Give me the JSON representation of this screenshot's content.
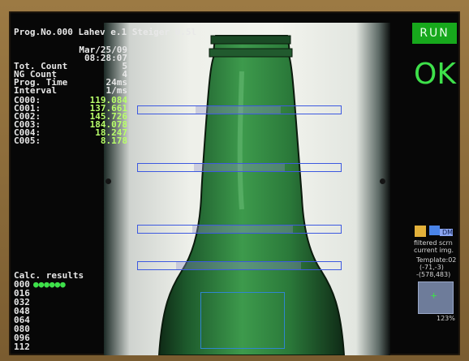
{
  "header": {
    "title": "Prog.No.000 Lahev e.1 Steiger 0.5l"
  },
  "status": {
    "run_label": "RUN",
    "result_label": "OK"
  },
  "info": {
    "date": "Mar/25/09",
    "time": "08:28:07",
    "rows": [
      {
        "label": "Tot. Count",
        "value": "5"
      },
      {
        "label": "NG Count",
        "value": "4"
      },
      {
        "label": "Prog. Time",
        "value": "24ms"
      },
      {
        "label": "Interval",
        "value": "1/ms"
      }
    ]
  },
  "measurements": [
    {
      "label": "C000:",
      "value": "119.084"
    },
    {
      "label": "C001:",
      "value": "137.661"
    },
    {
      "label": "C002:",
      "value": "145.726"
    },
    {
      "label": "C003:",
      "value": "184.078"
    },
    {
      "label": "C004:",
      "value": "18.247"
    },
    {
      "label": "C005:",
      "value": "8.178"
    }
  ],
  "calc_results": {
    "title": "Calc. results",
    "rows": [
      "000",
      "016",
      "032",
      "048",
      "064",
      "080",
      "096",
      "112"
    ],
    "first_row_dots": "●●●●●●"
  },
  "side_panel": {
    "filtered_label": "filtered scrn",
    "current_label": "current img.",
    "template_label": "Template:02",
    "offset_label": "(-71,-3)",
    "coord_label": "-(578,483)",
    "zoom_label": "123%",
    "icon_text": "DM"
  },
  "colors": {
    "run_bg": "#17a81c",
    "ok_text": "#3ee04a",
    "value_text": "#b8ff6a",
    "roi_border": "#3d59e0"
  },
  "icons": [
    "filter-swatch-icon",
    "current-image-swatch-icon",
    "crosshair-icon"
  ]
}
